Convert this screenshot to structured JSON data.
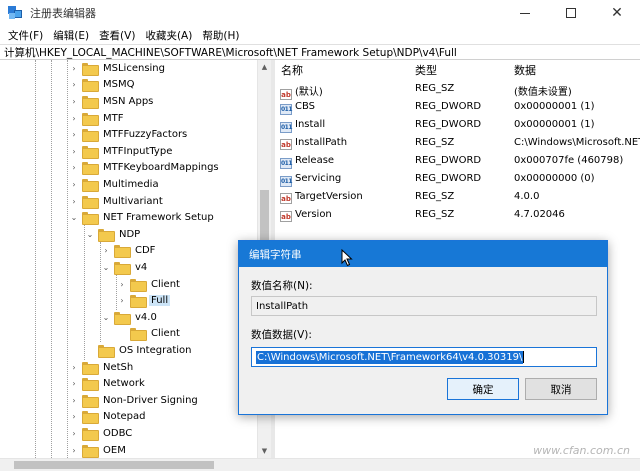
{
  "window": {
    "title": "注册表编辑器",
    "icon": "registry-editor-icon"
  },
  "menu": [
    "文件(F)",
    "编辑(E)",
    "查看(V)",
    "收藏夹(A)",
    "帮助(H)"
  ],
  "address": "计算机\\HKEY_LOCAL_MACHINE\\SOFTWARE\\Microsoft\\NET Framework Setup\\NDP\\v4\\Full",
  "tree": {
    "items": [
      {
        "label": "MSLicensing",
        "expander": "collapsed"
      },
      {
        "label": "MSMQ",
        "expander": "collapsed"
      },
      {
        "label": "MSN Apps",
        "expander": "collapsed"
      },
      {
        "label": "MTF",
        "expander": "collapsed"
      },
      {
        "label": "MTFFuzzyFactors",
        "expander": "collapsed"
      },
      {
        "label": "MTFInputType",
        "expander": "collapsed"
      },
      {
        "label": "MTFKeyboardMappings",
        "expander": "collapsed"
      },
      {
        "label": "Multimedia",
        "expander": "collapsed"
      },
      {
        "label": "Multivariant",
        "expander": "collapsed"
      },
      {
        "label": "NET Framework Setup",
        "expander": "expanded"
      },
      {
        "label": "NDP",
        "expander": "expanded"
      },
      {
        "label": "CDF",
        "expander": "collapsed"
      },
      {
        "label": "v4",
        "expander": "expanded"
      },
      {
        "label": "Client",
        "expander": "collapsed"
      },
      {
        "label": "Full",
        "expander": "collapsed",
        "selected": true
      },
      {
        "label": "v4.0",
        "expander": "expanded"
      },
      {
        "label": "Client",
        "expander": "none"
      },
      {
        "label": "OS Integration",
        "expander": "none"
      },
      {
        "label": "NetSh",
        "expander": "collapsed"
      },
      {
        "label": "Network",
        "expander": "collapsed"
      },
      {
        "label": "Non-Driver Signing",
        "expander": "collapsed"
      },
      {
        "label": "Notepad",
        "expander": "collapsed"
      },
      {
        "label": "ODBC",
        "expander": "collapsed"
      },
      {
        "label": "OEM",
        "expander": "collapsed"
      }
    ]
  },
  "list": {
    "headers": {
      "name": "名称",
      "type": "类型",
      "data": "数据"
    },
    "rows": [
      {
        "name": "(默认)",
        "type": "REG_SZ",
        "data": "(数值未设置)",
        "icon": "sz"
      },
      {
        "name": "CBS",
        "type": "REG_DWORD",
        "data": "0x00000001 (1)",
        "icon": "bin"
      },
      {
        "name": "Install",
        "type": "REG_DWORD",
        "data": "0x00000001 (1)",
        "icon": "bin"
      },
      {
        "name": "InstallPath",
        "type": "REG_SZ",
        "data": "C:\\Windows\\Microsoft.NET\\Fr",
        "icon": "sz"
      },
      {
        "name": "Release",
        "type": "REG_DWORD",
        "data": "0x000707fe (460798)",
        "icon": "bin"
      },
      {
        "name": "Servicing",
        "type": "REG_DWORD",
        "data": "0x00000000 (0)",
        "icon": "bin"
      },
      {
        "name": "TargetVersion",
        "type": "REG_SZ",
        "data": "4.0.0",
        "icon": "sz"
      },
      {
        "name": "Version",
        "type": "REG_SZ",
        "data": "4.7.02046",
        "icon": "sz"
      }
    ]
  },
  "dialog": {
    "title": "编辑字符串",
    "name_label": "数值名称(N):",
    "name_value": "InstallPath",
    "data_label": "数值数据(V):",
    "data_value": "C:\\Windows\\Microsoft.NET\\Framework64\\v4.0.30319\\",
    "ok_label": "确定",
    "cancel_label": "取消"
  },
  "watermark": "www.cfan.com.cn",
  "colors": {
    "accent": "#1778d6",
    "selection": "#cce4f7",
    "folder": "#f3c94d"
  }
}
